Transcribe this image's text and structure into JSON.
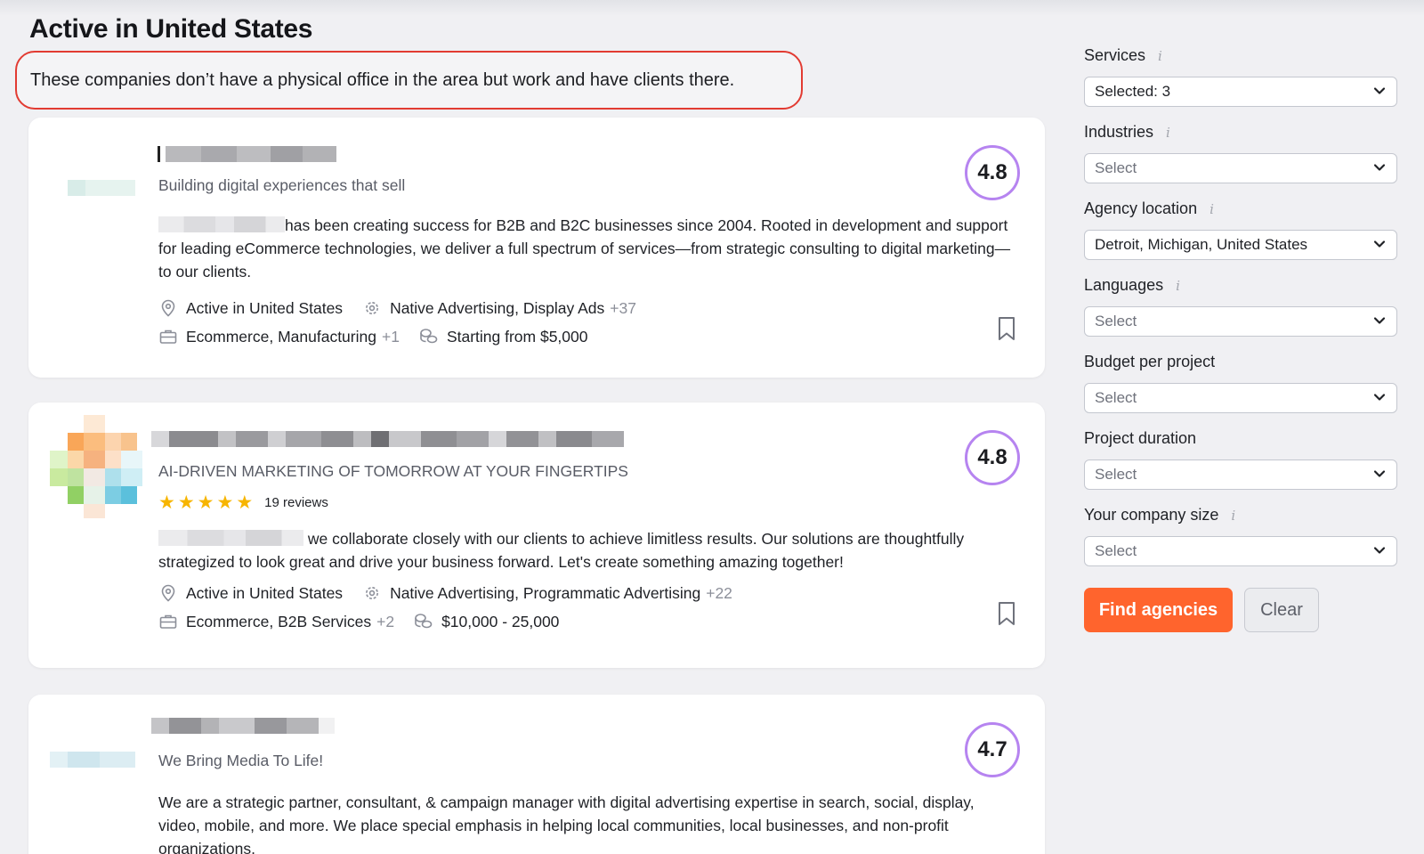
{
  "page_title": "Active in United States",
  "notice": "These companies don’t have a physical office in the area but work and have clients there.",
  "cards": [
    {
      "tagline": "Building digital experiences that sell",
      "description": "has been creating success for B2B and B2C businesses since 2004. Rooted in development and support for leading eCommerce technologies, we deliver a full spectrum of services—from strategic consulting to digital marketing—to our clients.",
      "rating": "4.8",
      "location": "Active in United States",
      "services": "Native Advertising, Display Ads",
      "services_more": "+37",
      "industries": "Ecommerce, Manufacturing",
      "industries_more": "+1",
      "budget": "Starting from $5,000"
    },
    {
      "tagline": "AI-DRIVEN MARKETING OF TOMORROW AT YOUR FINGERTIPS",
      "stars": 5,
      "reviews": "19 reviews",
      "description": "we collaborate closely with our clients to achieve limitless results. Our solutions are thoughtfully strategized to look great and drive your business forward. Let's create something amazing together!",
      "rating": "4.8",
      "location": "Active in United States",
      "services": "Native Advertising, Programmatic Advertising",
      "services_more": "+22",
      "industries": "Ecommerce, B2B Services",
      "industries_more": "+2",
      "budget": "$10,000 - 25,000"
    },
    {
      "tagline": "We Bring Media To Life!",
      "description": "We are a strategic partner, consultant, & campaign manager with digital advertising expertise in search, social, display, video, mobile, and more. We place special emphasis in helping local communities, local businesses, and non-profit organizations.",
      "rating": "4.7"
    }
  ],
  "filters": {
    "services": {
      "label": "Services",
      "value": "Selected: 3"
    },
    "industries": {
      "label": "Industries",
      "value": "Select"
    },
    "location": {
      "label": "Agency location",
      "value": "Detroit, Michigan, United States"
    },
    "languages": {
      "label": "Languages",
      "value": "Select"
    },
    "budget": {
      "label": "Budget per project",
      "value": "Select"
    },
    "duration": {
      "label": "Project duration",
      "value": "Select"
    },
    "company_size": {
      "label": "Your company size",
      "value": "Select"
    }
  },
  "info_glyph": "i",
  "buttons": {
    "find": "Find agencies",
    "clear": "Clear"
  },
  "colors": {
    "accent": "#ff642d",
    "rating_ring": "#b684f0",
    "star": "#f7b500",
    "notice_border": "#e23b32"
  }
}
